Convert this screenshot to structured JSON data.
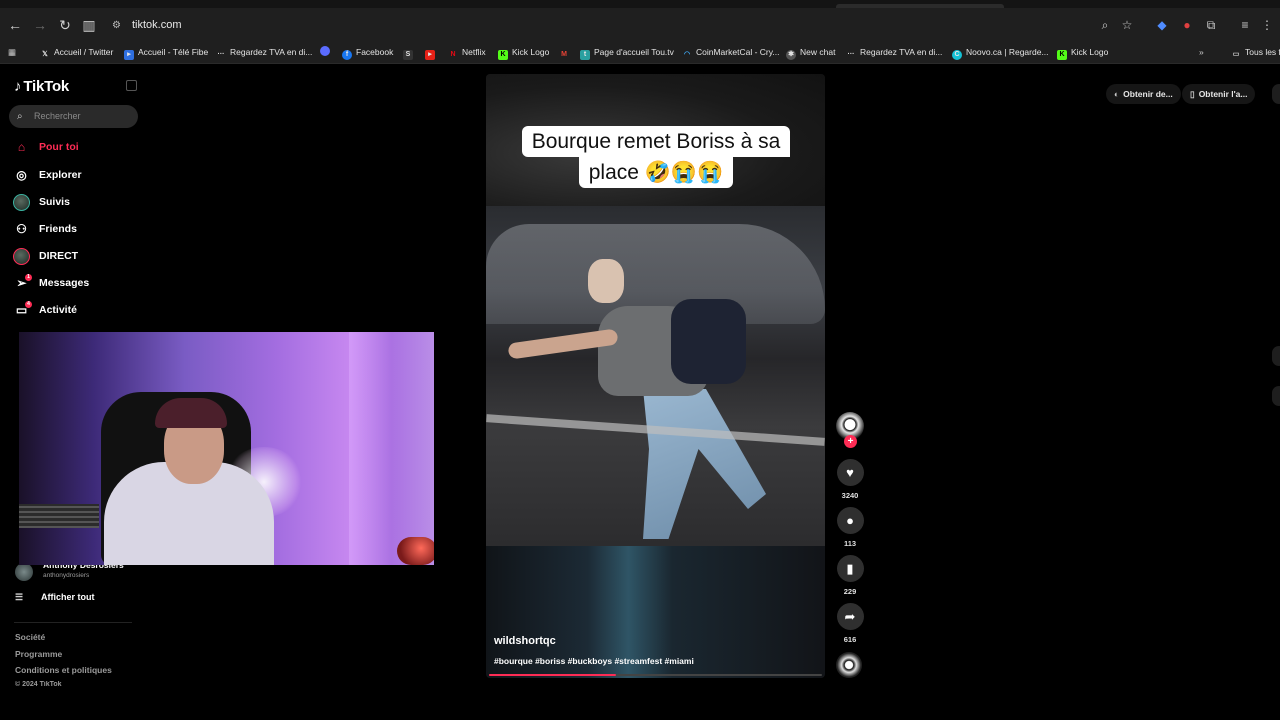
{
  "browser": {
    "url": "tiktok.com",
    "bookmarks": [
      {
        "label": "Accueil / Twitter",
        "icon": "x-icon"
      },
      {
        "label": "Accueil - Télé Fibe",
        "icon": "play-icon"
      },
      {
        "label": "Regardez TVA en di...",
        "icon": "dots-icon"
      },
      {
        "label": "",
        "icon": "messenger-icon"
      },
      {
        "label": "Facebook",
        "icon": "facebook-icon"
      },
      {
        "label": "",
        "icon": "s-icon"
      },
      {
        "label": "",
        "icon": "youtube-icon"
      },
      {
        "label": "Netflix",
        "icon": "netflix-icon"
      },
      {
        "label": "Kick Logo",
        "icon": "kick-icon"
      },
      {
        "label": "",
        "icon": "gmail-icon"
      },
      {
        "label": "Page d'accueil Tou.tv",
        "icon": "toutv-icon"
      },
      {
        "label": "CoinMarketCal - Cry...",
        "icon": "coin-icon"
      },
      {
        "label": "New chat",
        "icon": "chat-icon"
      },
      {
        "label": "Regardez TVA en di...",
        "icon": "dots-icon"
      },
      {
        "label": "Noovo.ca | Regarde...",
        "icon": "noovo-icon"
      },
      {
        "label": "Kick Logo",
        "icon": "kick-icon"
      }
    ],
    "all_bookmarks": "Tous les f"
  },
  "sidebar": {
    "logo": "TikTok",
    "search_placeholder": "Rechercher",
    "nav": {
      "for_you": "Pour toi",
      "explore": "Explorer",
      "following": "Suivis",
      "friends": "Friends",
      "live": "DIRECT",
      "messages": "Messages",
      "activity": "Activité"
    },
    "messages_badge": "1",
    "activity_badge": "4",
    "followed_user": {
      "name": "Anthony Desrosiers",
      "handle": "anthonydrosiers"
    },
    "show_all": "Afficher tout",
    "footer": {
      "company": "Société",
      "program": "Programme",
      "terms": "Conditions et politiques",
      "copyright": "© 2024 TikTok"
    }
  },
  "video": {
    "caption_line1": "Bourque remet Boriss à sa",
    "caption_line2": "place 🤣😭😭",
    "author": "wildshortqc",
    "hashtags": "#bourque #boriss #buckboys #streamfest #miami",
    "progress": 0.38
  },
  "actions": {
    "likes": "3240",
    "comments": "113",
    "saves": "229",
    "shares": "616"
  },
  "header_buttons": {
    "get_desktop": "Obtenir de...",
    "get_app": "Obtenir l'a..."
  },
  "colors": {
    "accent": "#fe2c55",
    "background": "#000000",
    "chrome": "#1f1f1f"
  }
}
